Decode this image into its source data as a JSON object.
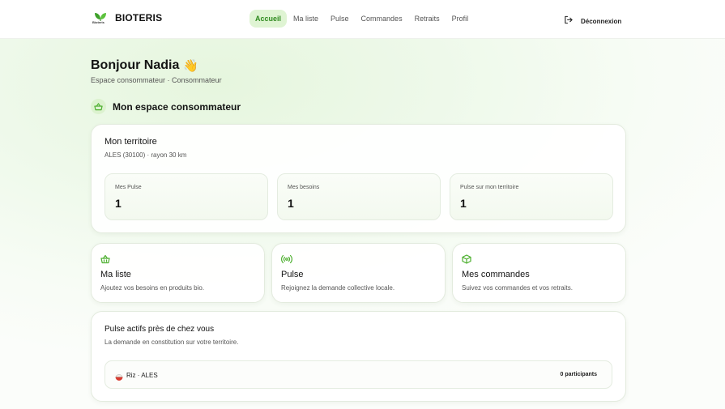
{
  "brand": {
    "name": "BIOTERIS",
    "logo_text": "Bioteris",
    "color": "#4caf2e"
  },
  "nav": {
    "items": [
      {
        "label": "Accueil",
        "active": true
      },
      {
        "label": "Ma liste",
        "active": false
      },
      {
        "label": "Pulse",
        "active": false
      },
      {
        "label": "Commandes",
        "active": false
      },
      {
        "label": "Retraits",
        "active": false
      },
      {
        "label": "Profil",
        "active": false
      }
    ],
    "logout_label": "Déconnexion",
    "logout_icon": "logout-icon"
  },
  "header": {
    "greeting": "Bonjour Nadia",
    "greeting_emoji": "👋",
    "subtitle": "Espace consommateur · Consommateur"
  },
  "section": {
    "title": "Mon espace consommateur",
    "icon": "basket-icon"
  },
  "territory": {
    "title": "Mon territoire",
    "subtitle": "ALES (30100) · rayon 30 km",
    "stats": [
      {
        "label": "Mes Pulse",
        "value": "1"
      },
      {
        "label": "Mes besoins",
        "value": "1"
      },
      {
        "label": "Pulse sur mon territoire",
        "value": "1"
      }
    ]
  },
  "features": [
    {
      "icon": "basket-icon",
      "title": "Ma liste",
      "description": "Ajoutez vos besoins en produits bio."
    },
    {
      "icon": "broadcast-icon",
      "title": "Pulse",
      "description": "Rejoignez la demande collective locale."
    },
    {
      "icon": "package-icon",
      "title": "Mes commandes",
      "description": "Suivez vos commandes et vos retraits."
    }
  ],
  "pulse": {
    "title": "Pulse actifs près de chez vous",
    "subtitle": "La demande en constitution sur votre territoire.",
    "items": [
      {
        "icon": "rice-bowl-icon",
        "label": "Riz · ALES",
        "count": "0 participants"
      }
    ]
  },
  "colors": {
    "accent": "#4caf2e",
    "accent_light": "#dff4d3",
    "accent_text": "#2f8a1f"
  }
}
